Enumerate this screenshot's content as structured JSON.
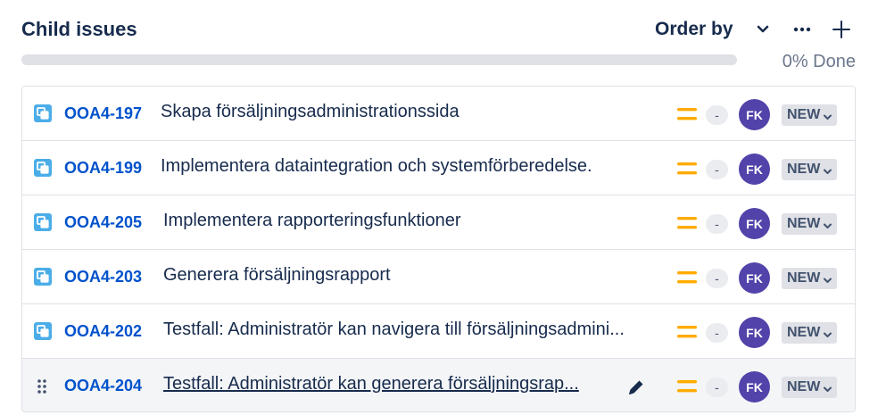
{
  "header": {
    "title": "Child issues",
    "order_by_label": "Order by",
    "progress_percent": 0,
    "progress_label": "0% Done"
  },
  "colors": {
    "key_link": "#0052cc",
    "priority_medium": "#ffab00",
    "avatar_bg": "#5243aa",
    "type_icon": "#4bade8",
    "status_bg": "#dfe1e6"
  },
  "icons": {
    "type": "subtask-icon",
    "priority": "priority-medium-icon",
    "drag": "drag-handle-icon",
    "edit": "pencil-icon"
  },
  "issues": [
    {
      "key": "OOA4-197",
      "summary": "Skapa försäljningsadministrationssida",
      "estimate": "-",
      "assignee": "FK",
      "status": "NEW"
    },
    {
      "key": "OOA4-199",
      "summary": "Implementera dataintegration och systemförberedelse.",
      "estimate": "-",
      "assignee": "FK",
      "status": "NEW"
    },
    {
      "key": "OOA4-205",
      "summary": "Implementera rapporteringsfunktioner",
      "estimate": "-",
      "assignee": "FK",
      "status": "NEW"
    },
    {
      "key": "OOA4-203",
      "summary": "Generera försäljningsrapport",
      "estimate": "-",
      "assignee": "FK",
      "status": "NEW"
    },
    {
      "key": "OOA4-202",
      "summary": "Testfall: Administratör kan navigera till försäljningsadmini...",
      "estimate": "-",
      "assignee": "FK",
      "status": "NEW"
    },
    {
      "key": "OOA4-204",
      "summary": "Testfall: Administratör kan generera försäljningsrap...",
      "estimate": "-",
      "assignee": "FK",
      "status": "NEW"
    }
  ]
}
